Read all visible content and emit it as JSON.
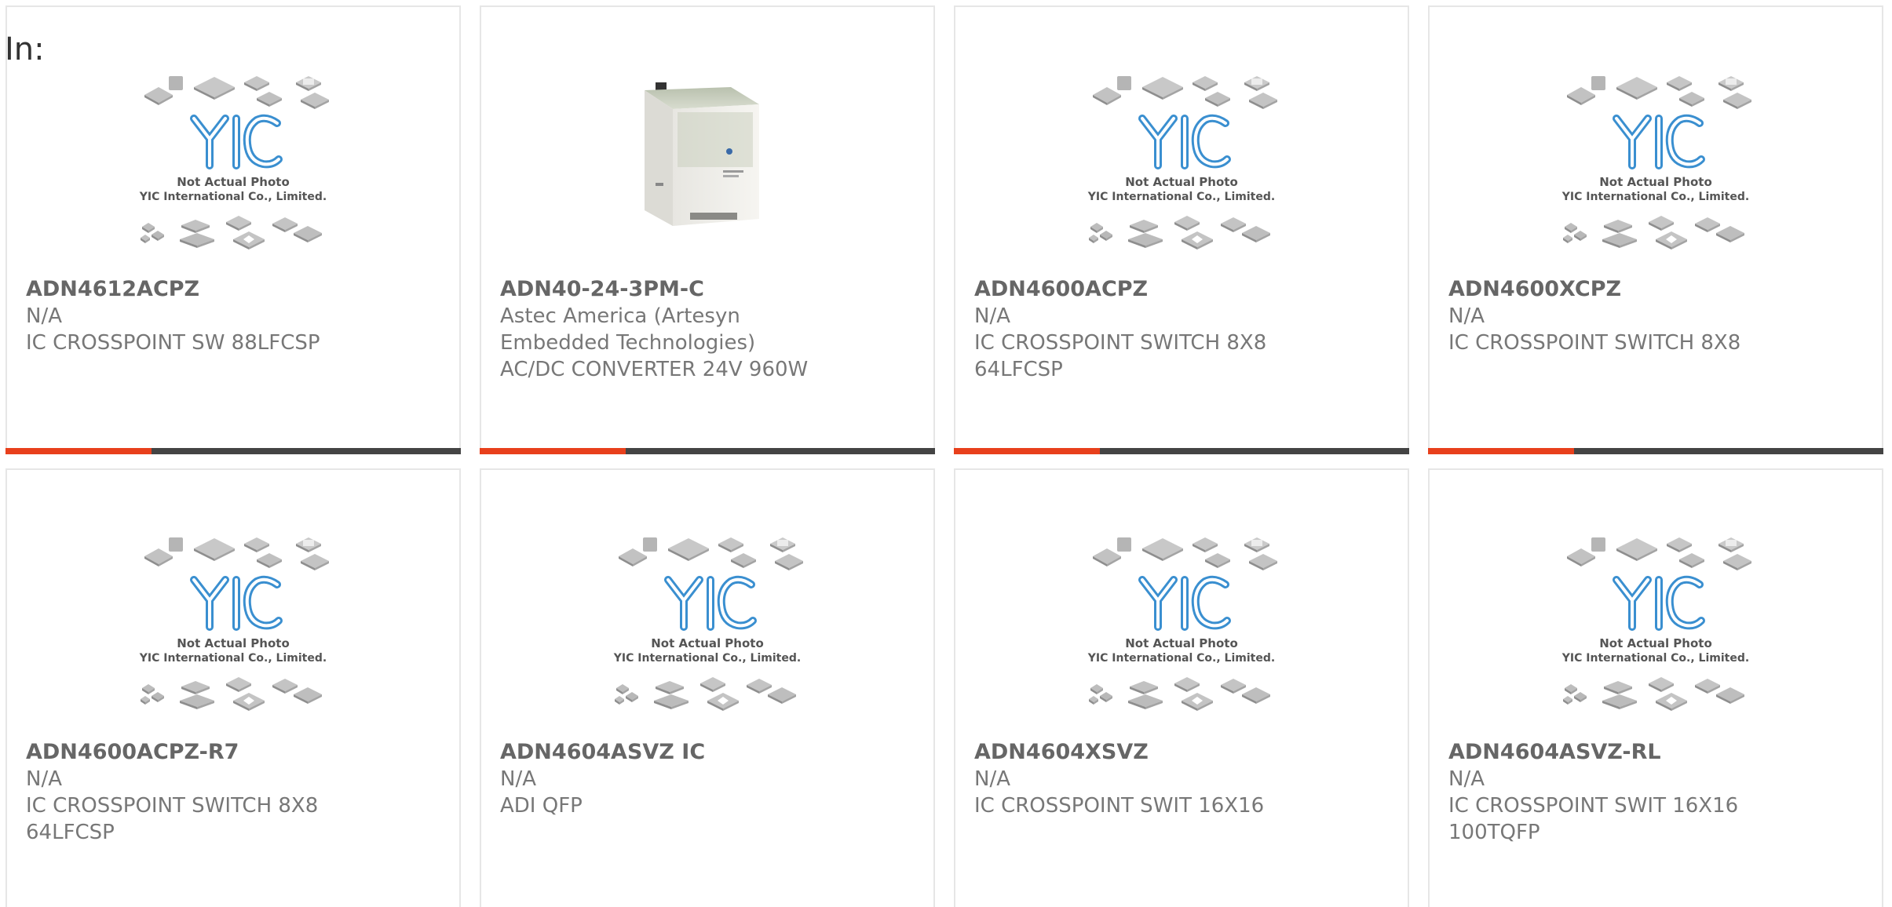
{
  "filter": {
    "label": "In:"
  },
  "accent_color": "#e8401c",
  "bar_color": "#444444",
  "placeholder_image": {
    "line1": "Not Actual Photo",
    "line2": "YIC International Co., Limited.",
    "logo": "YIC",
    "icon": "yic-placeholder-icon"
  },
  "products": [
    {
      "part": "ADN4612ACPZ",
      "manufacturer": "N/A",
      "desc_lines": [
        "IC CROSSPOINT SW 88LFCSP"
      ],
      "image": "placeholder",
      "progress": 0.32
    },
    {
      "part": "ADN40-24-3PM-C",
      "manufacturer_lines": [
        "Astec America (Artesyn",
        "Embedded Technologies)"
      ],
      "desc_lines": [
        "AC/DC CONVERTER 24V 960W"
      ],
      "image": "psu-photo",
      "progress": 0.32
    },
    {
      "part": "ADN4600ACPZ",
      "manufacturer": "N/A",
      "desc_lines": [
        "IC CROSSPOINT SWITCH 8X8",
        "64LFCSP"
      ],
      "image": "placeholder",
      "progress": 0.32
    },
    {
      "part": "ADN4600XCPZ",
      "manufacturer": "N/A",
      "desc_lines": [
        "IC CROSSPOINT SWITCH 8X8"
      ],
      "image": "placeholder",
      "progress": 0.32
    },
    {
      "part": "ADN4600ACPZ-R7",
      "manufacturer": "N/A",
      "desc_lines": [
        "IC CROSSPOINT SWITCH 8X8",
        "64LFCSP"
      ],
      "image": "placeholder"
    },
    {
      "part": "ADN4604ASVZ IC",
      "manufacturer": "N/A",
      "desc_lines": [
        "ADI QFP"
      ],
      "image": "placeholder"
    },
    {
      "part": "ADN4604XSVZ",
      "manufacturer": "N/A",
      "desc_lines": [
        "IC CROSSPOINT SWIT 16X16"
      ],
      "image": "placeholder"
    },
    {
      "part": "ADN4604ASVZ-RL",
      "manufacturer": "N/A",
      "desc_lines": [
        "IC CROSSPOINT SWIT 16X16",
        "100TQFP"
      ],
      "image": "placeholder"
    }
  ]
}
